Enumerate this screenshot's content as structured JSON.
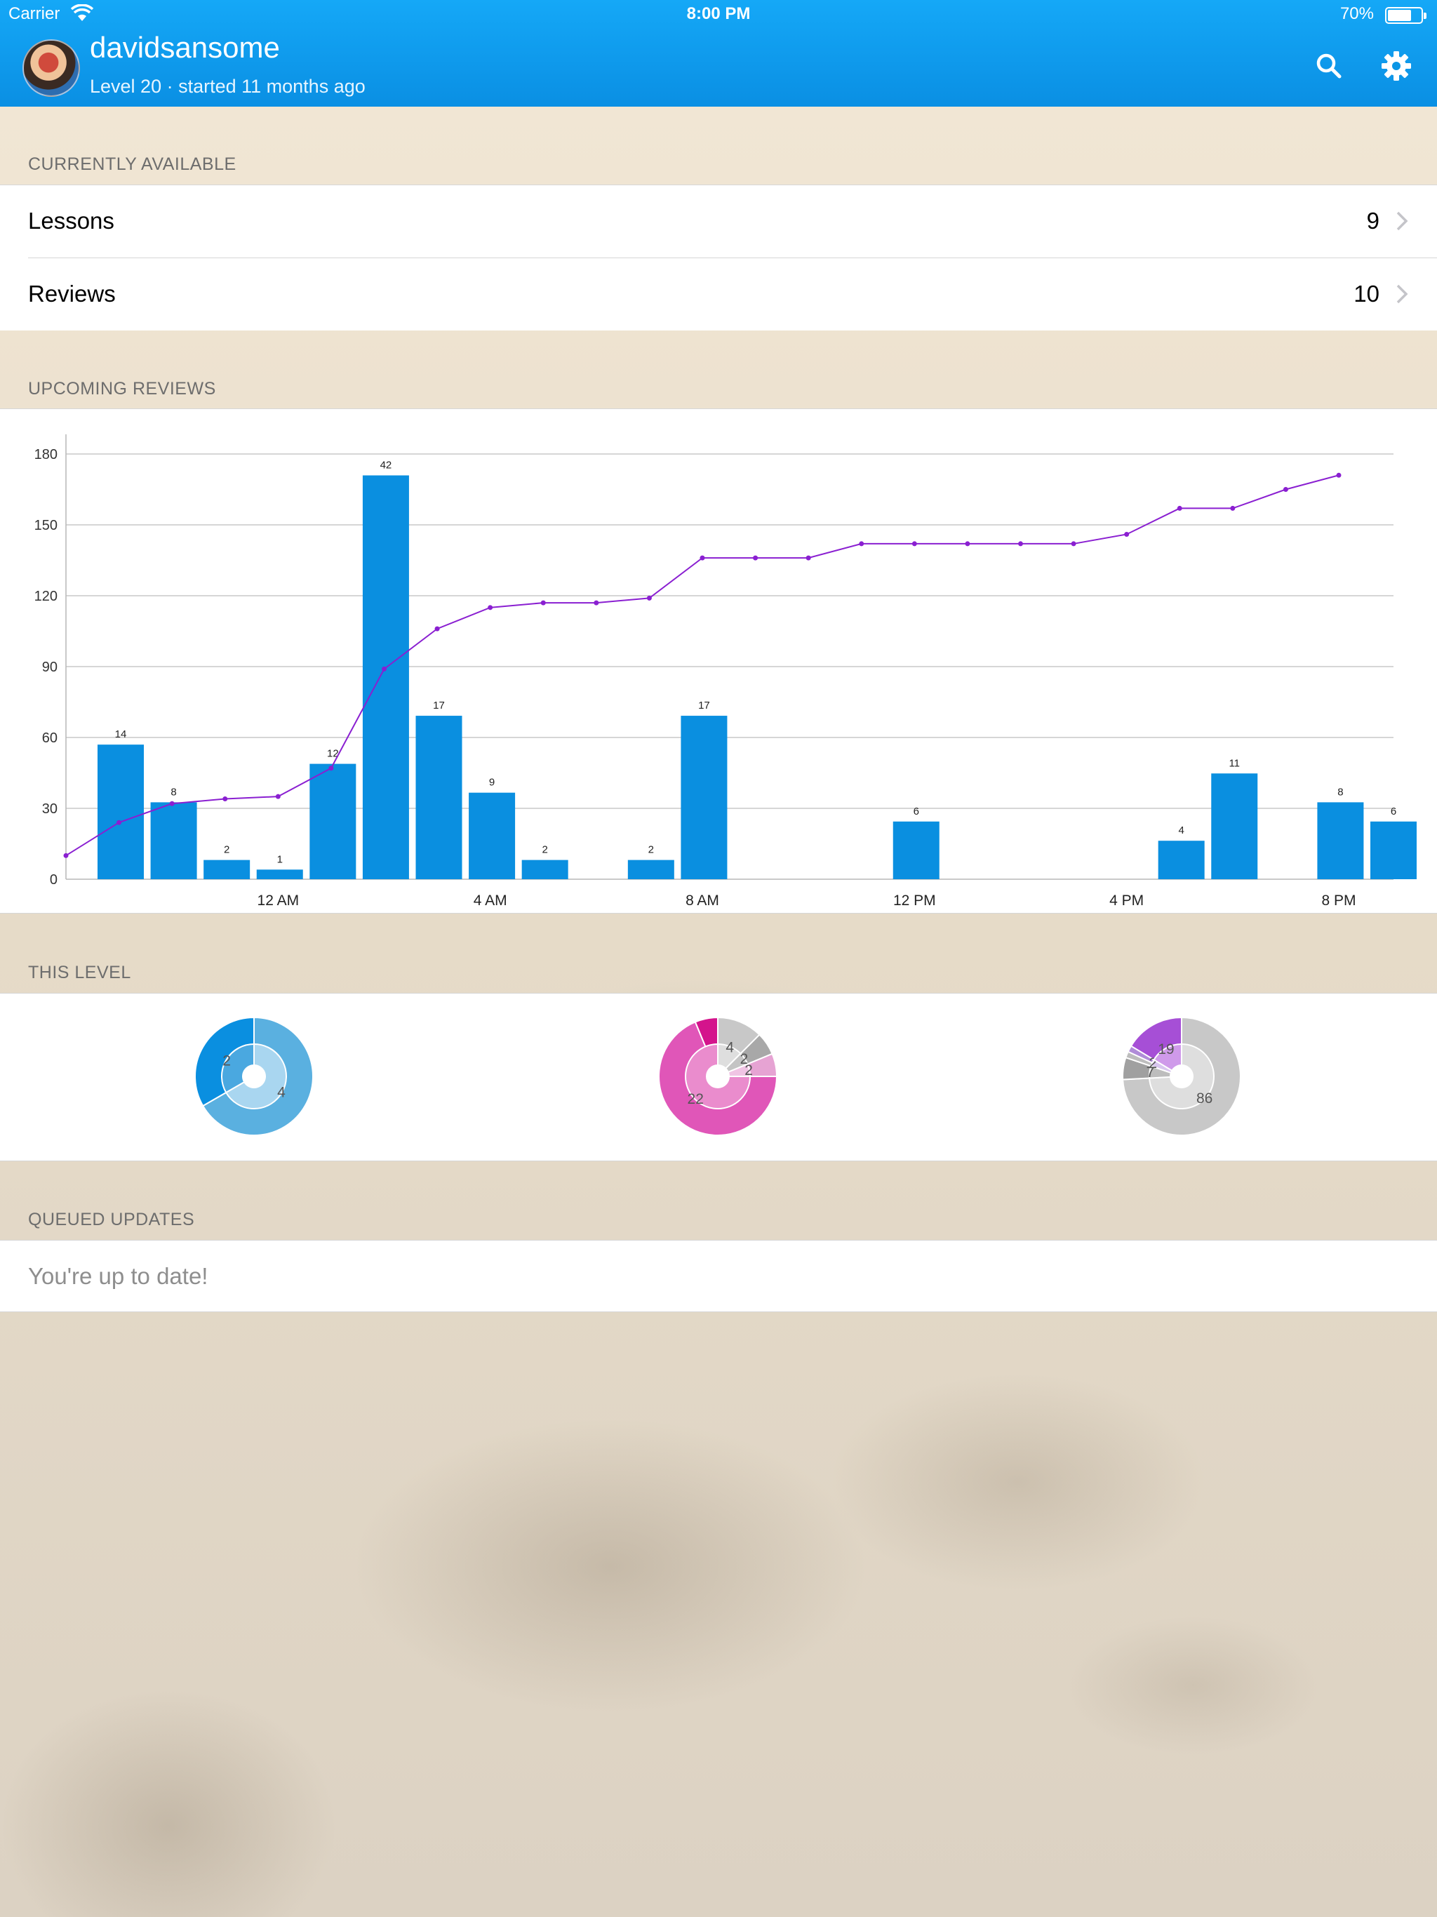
{
  "status_bar": {
    "carrier": "Carrier",
    "time": "8:00 PM",
    "battery": "70%"
  },
  "header": {
    "username": "davidsansome",
    "subtitle": "Level 20 · started 11 months ago",
    "search_icon": "search-icon",
    "settings_icon": "gear-icon",
    "bar_color": "#0a9ae8"
  },
  "currently_available": {
    "section_title": "CURRENTLY AVAILABLE",
    "rows": [
      {
        "label": "Lessons",
        "count": "9"
      },
      {
        "label": "Reviews",
        "count": "10"
      }
    ]
  },
  "upcoming_reviews": {
    "section_title": "UPCOMING REVIEWS"
  },
  "chart_data": {
    "type": "bar",
    "title": "",
    "xlabel": "",
    "ylabel": "",
    "ylim": [
      0,
      180
    ],
    "yticks": [
      0,
      30,
      60,
      90,
      120,
      150,
      180
    ],
    "grid": true,
    "x_tick_labels": [
      {
        "label": "12 AM",
        "index": 4
      },
      {
        "label": "4 AM",
        "index": 8
      },
      {
        "label": "8 AM",
        "index": 12
      },
      {
        "label": "12 PM",
        "index": 16
      },
      {
        "label": "4 PM",
        "index": 20
      },
      {
        "label": "8 PM",
        "index": 24
      }
    ],
    "series": [
      {
        "type": "bar",
        "color": "#0a8fe0",
        "values": [
          14,
          8,
          2,
          1,
          12,
          42,
          17,
          9,
          2,
          0,
          2,
          17,
          0,
          0,
          0,
          6,
          0,
          0,
          0,
          0,
          4,
          11,
          0,
          8,
          6
        ],
        "bar_labels": [
          "14",
          "8",
          "2",
          "1",
          "12",
          "42",
          "17",
          "9",
          "2",
          "",
          "2",
          "17",
          "",
          "",
          "",
          "6",
          "",
          "",
          "",
          "",
          "4",
          "11",
          "",
          "8",
          "6"
        ]
      },
      {
        "type": "line",
        "color": "#8a1fd1",
        "values": [
          10,
          24,
          32,
          34,
          35,
          47,
          89,
          106,
          115,
          117,
          117,
          119,
          136,
          136,
          136,
          142,
          142,
          142,
          142,
          142,
          146,
          157,
          157,
          165,
          171
        ]
      }
    ]
  },
  "this_level": {
    "section_title": "THIS LEVEL",
    "pies": [
      {
        "name": "radicals",
        "outer": [
          {
            "value": 4,
            "color": "#5ab0e0"
          },
          {
            "value": 2,
            "color": "#0a8fe0"
          }
        ],
        "inner": [
          {
            "value": 4,
            "color": "#a9d6f0",
            "label": "4"
          },
          {
            "value": 2,
            "color": "#4aa8e0",
            "label": "2"
          }
        ]
      },
      {
        "name": "kanji",
        "outer": [
          {
            "value": 4,
            "color": "#c8c8c8"
          },
          {
            "value": 2,
            "color": "#a8a8a8"
          },
          {
            "value": 2,
            "color": "#e6a3d3"
          },
          {
            "value": 22,
            "color": "#e056b8"
          },
          {
            "value": 2,
            "color": "#d4148c"
          }
        ],
        "inner": [
          {
            "value": 4,
            "color": "#dedede",
            "label": "4"
          },
          {
            "value": 2,
            "color": "#c4c4c4",
            "label": "2"
          },
          {
            "value": 2,
            "color": "#f0c4e4",
            "label": "2"
          },
          {
            "value": 24,
            "color": "#ea8ccd",
            "label": "22"
          }
        ]
      },
      {
        "name": "vocabulary",
        "outer": [
          {
            "value": 86,
            "color": "#c8c8c8"
          },
          {
            "value": 7,
            "color": "#a0a0a0"
          },
          {
            "value": 2,
            "color": "#bdbdbd"
          },
          {
            "value": 2,
            "color": "#b08cd8"
          },
          {
            "value": 19,
            "color": "#a64fd6"
          }
        ],
        "inner": [
          {
            "value": 86,
            "color": "#dedede",
            "label": "86"
          },
          {
            "value": 7,
            "color": "#bdbdbd",
            "label": "7"
          },
          {
            "value": 4,
            "color": "#d8c6ee",
            "label": "2"
          },
          {
            "value": 19,
            "color": "#cf9aea",
            "label": "19"
          }
        ]
      }
    ]
  },
  "queued_updates": {
    "section_title": "QUEUED UPDATES",
    "message": "You're up to date!"
  }
}
